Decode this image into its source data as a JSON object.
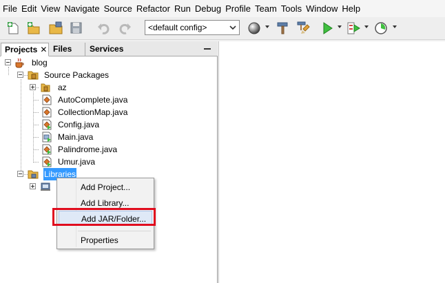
{
  "menu": [
    "File",
    "Edit",
    "View",
    "Navigate",
    "Source",
    "Refactor",
    "Run",
    "Debug",
    "Profile",
    "Team",
    "Tools",
    "Window",
    "Help"
  ],
  "toolbar": {
    "buttons": [
      "new-file-icon",
      "new-project-icon",
      "open-project-icon",
      "save-all-icon",
      "undo-icon",
      "redo-icon",
      "globe-icon",
      "build-hammer-icon",
      "clean-build-icon",
      "run-icon",
      "debug-icon",
      "profile-icon"
    ],
    "config_value": "<default config>"
  },
  "panel": {
    "tabs": [
      "Projects",
      "Files",
      "Services"
    ],
    "close_symbol": "✕"
  },
  "tree": {
    "project": "blog",
    "source_packages": "Source Packages",
    "package": "az",
    "files": [
      "AutoComplete.java",
      "CollectionMap.java",
      "Config.java",
      "Main.java",
      "Palindrome.java",
      "Umur.java"
    ],
    "libraries": "Libraries"
  },
  "context_menu": {
    "items": [
      "Add Project...",
      "Add Library...",
      "Add JAR/Folder...",
      "Properties"
    ],
    "highlighted": "Add JAR/Folder..."
  },
  "colors": {
    "selection": "#3399ff",
    "highlight_box": "#e00d1e",
    "run_green": "#2ea02e"
  }
}
